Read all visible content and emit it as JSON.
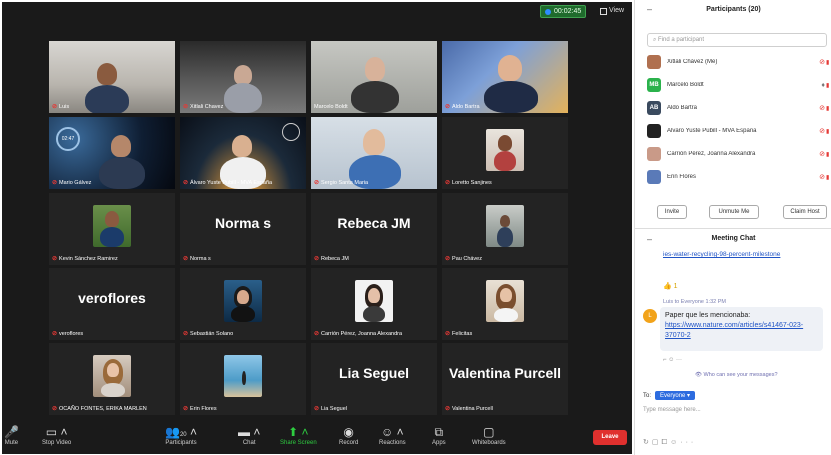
{
  "meeting": {
    "timer": "00:02:45",
    "view_label": "View"
  },
  "tiles": [
    {
      "name": "Luis"
    },
    {
      "name": "Xitlali Chavez"
    },
    {
      "name": "Marcelo Boldt"
    },
    {
      "name": "Aldo Bartra"
    },
    {
      "name": "Mario Gálvez"
    },
    {
      "name": "Álvaro Yuste Pubill - MVA España"
    },
    {
      "name": "Sergio Santa Maria"
    },
    {
      "name": "Loretto Sanjines"
    },
    {
      "name": "Kevin Sánchez Ramirez"
    },
    {
      "name": "Norma s",
      "big": "Norma s"
    },
    {
      "name": "Rebeca JM",
      "big": "Rebeca JM"
    },
    {
      "name": "Pau Chávez"
    },
    {
      "name": "veroflores",
      "big": "veroflores"
    },
    {
      "name": "Sebastián Solano"
    },
    {
      "name": "Carrión Pérez, Joanna Alexandra"
    },
    {
      "name": "Felicitas"
    },
    {
      "name": "OCAÑO FONTES, ERIKA MARLEN"
    },
    {
      "name": "Erin Flores"
    },
    {
      "name": "Lia Seguel",
      "big": "Lia Seguel"
    },
    {
      "name": "Valentina Purcell",
      "big": "Valentina Purcell"
    }
  ],
  "toolbar": {
    "mute": "Mute",
    "stop_video": "Stop Video",
    "participants": "Participants",
    "participants_count": "20",
    "chat": "Chat",
    "share_screen": "Share Screen",
    "record": "Record",
    "reactions": "Reactions",
    "apps": "Apps",
    "whiteboards": "Whiteboards",
    "leave": "Leave"
  },
  "participants_panel": {
    "title": "Participants (20)",
    "search_placeholder": "Find a participant",
    "list": [
      {
        "name": "Xitlali Chávez (Me)",
        "initials": "",
        "color": "#b07050"
      },
      {
        "name": "Marcelo Boldt",
        "initials": "MB",
        "color": "#2bb24c"
      },
      {
        "name": "Aldo Bartra",
        "initials": "AB",
        "color": "#3a4a5e"
      },
      {
        "name": "Álvaro Yuste Pubill - MVA España",
        "initials": "",
        "color": "#222222"
      },
      {
        "name": "Carrión Pérez, Joanna Alexandra",
        "initials": "",
        "color": "#c99a88"
      },
      {
        "name": "Erin Flores",
        "initials": "",
        "color": "#5a7ab8"
      }
    ],
    "invite": "Invite",
    "unmute_me": "Unmute Me",
    "claim_host": "Claim Host"
  },
  "chat": {
    "title": "Meeting Chat",
    "prev_link": "ies-water-recycling-98-percent-milestone",
    "reaction": "👍 1",
    "meta": "Luis to Everyone  1:32 PM",
    "avatar": "L",
    "message": "Paper que les mencionaba:",
    "link": "https://www.nature.com/articles/s41467-023-37070-2",
    "who_can_see": "Who can see your messages?",
    "to_label": "To:",
    "to_value": "Everyone ▾",
    "input_placeholder": "Type message here..."
  },
  "colors": {
    "accent_green": "#2ecc40",
    "leave_red": "#e0302e",
    "active_speaker": "#b6e36a",
    "link_blue": "#1f53c5"
  }
}
